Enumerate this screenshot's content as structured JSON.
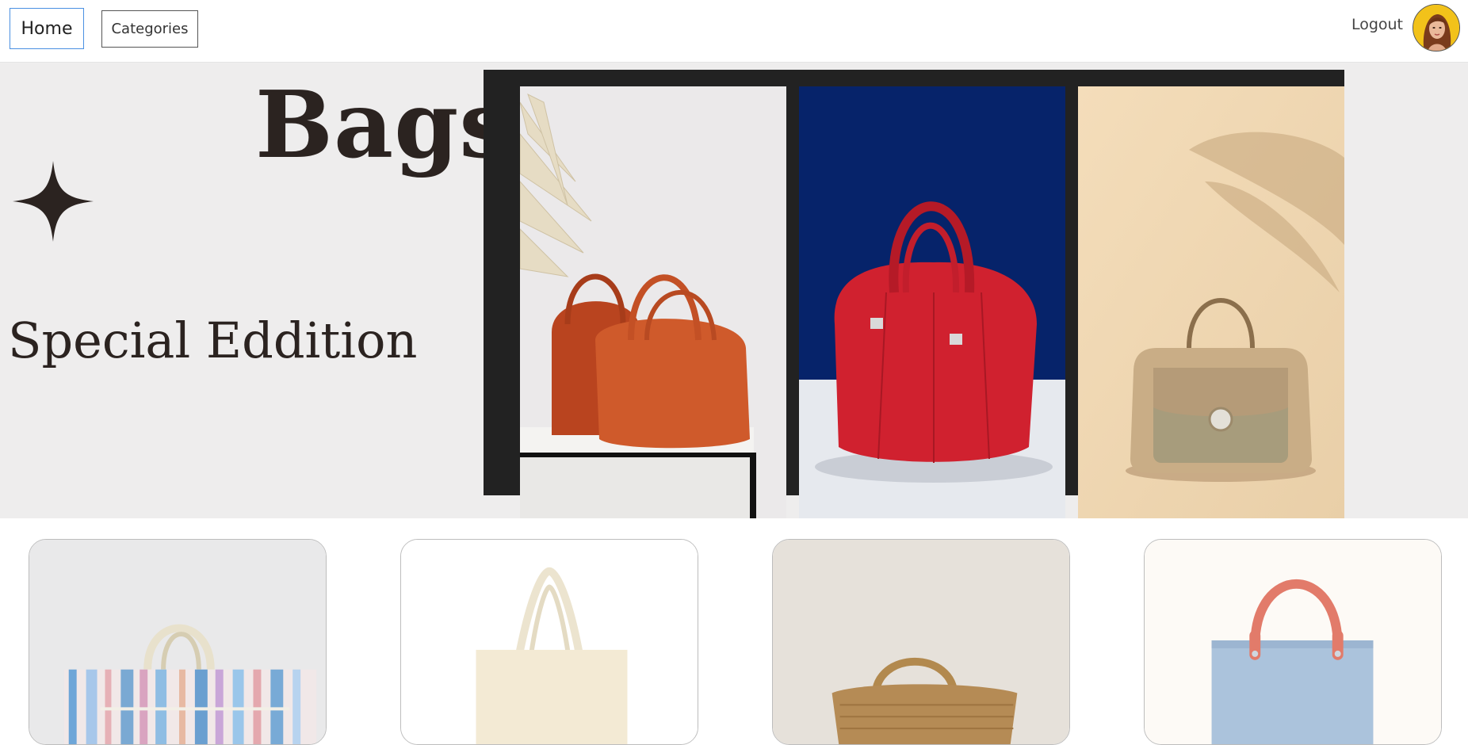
{
  "nav": {
    "home_label": "Home",
    "categories_label": "Categories",
    "logout_label": "Logout",
    "avatar_icon": "user-avatar"
  },
  "hero": {
    "title": "Bags",
    "subtitle": "Special Eddition",
    "sparkle_icon": "four-point-star-icon",
    "photos": [
      {
        "subject": "two orange leather handbags on white pedestal"
      },
      {
        "subject": "red leather doctor bag on blue background"
      },
      {
        "subject": "beige woven top-handle handbag"
      }
    ]
  },
  "products": [
    {
      "subject": "striped canvas tote bag"
    },
    {
      "subject": "plain cream canvas tote bag"
    },
    {
      "subject": "woven straw basket bag"
    },
    {
      "subject": "light blue tote with coral handles"
    }
  ],
  "colors": {
    "hero_background": "#eeeded",
    "frame": "#222222",
    "title_text": "#2b2320",
    "home_border": "#4a90e2"
  }
}
